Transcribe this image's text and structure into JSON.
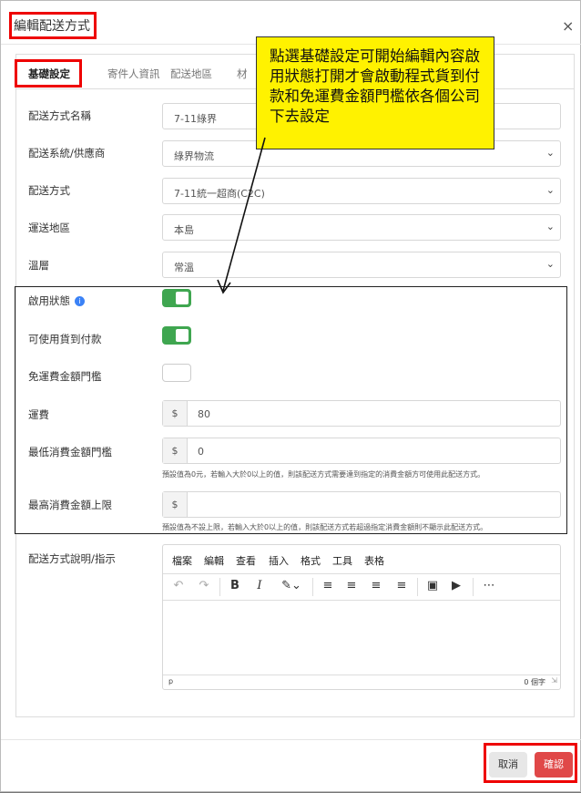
{
  "modal": {
    "title": "編輯配送方式",
    "close": "×"
  },
  "tabs": [
    "基礎設定",
    "寄件人資訊",
    "配送地區",
    "材"
  ],
  "callout": "點選基礎設定可開始編輯內容啟用狀態打開才會啟動程式貨到付款和免運費金額門檻依各個公司下去設定",
  "form": {
    "name_label": "配送方式名稱",
    "name_value": "7-11綠界",
    "system_label": "配送系統/供應商",
    "system_value": "綠界物流",
    "method_label": "配送方式",
    "method_value": "7-11統一超商(C2C)",
    "region_label": "運送地區",
    "region_value": "本島",
    "temp_label": "溫層",
    "temp_value": "常溫",
    "status_label": "啟用狀態",
    "status_on": true,
    "cod_label": "可使用貨到付款",
    "cod_on": true,
    "free_label": "免運費金額門檻",
    "free_on": false,
    "fee_label": "運費",
    "fee_value": "80",
    "currency": "$",
    "min_label": "最低消費金額門檻",
    "min_value": "0",
    "min_help": "預設值為0元，若輸入大於0以上的值，則該配送方式需要達到指定的消費金額方可使用此配送方式。",
    "max_label": "最高消費金額上限",
    "max_value": "",
    "max_help": "預設值為不設上限，若輸入大於0以上的值，則該配送方式若超過指定消費金額則不顯示此配送方式。",
    "desc_label": "配送方式說明/指示"
  },
  "editor": {
    "menus": [
      "檔案",
      "編輯",
      "查看",
      "插入",
      "格式",
      "工具",
      "表格"
    ],
    "path": "p",
    "count": "0 個字"
  },
  "footer": {
    "cancel": "取消",
    "confirm": "確認"
  },
  "colors": {
    "highlight": "#e00000",
    "toggle_on": "#3fa650",
    "confirm": "#e04848",
    "callout": "#fff200"
  }
}
